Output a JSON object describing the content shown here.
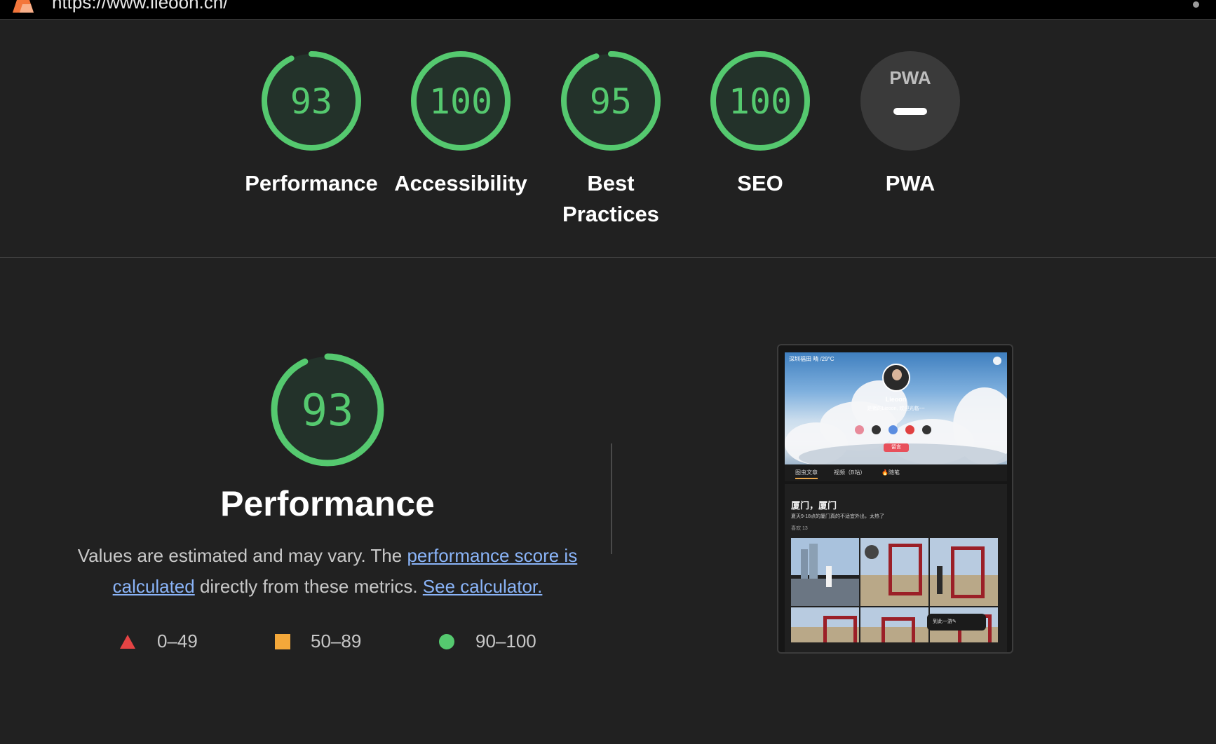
{
  "topbar": {
    "url": "https://www.lieoon.cn/"
  },
  "colors": {
    "pass": "#55c96f",
    "average": "#f4a83a",
    "fail": "#e54444",
    "gauge_bg": "#23322a",
    "na": "#3a3a3a"
  },
  "scores": [
    {
      "label": "Performance",
      "value": 93
    },
    {
      "label": "Accessibility",
      "value": 100
    },
    {
      "label": "Best Practices",
      "value": 95
    },
    {
      "label": "SEO",
      "value": 100
    },
    {
      "label": "PWA",
      "value": null,
      "badge": "PWA"
    }
  ],
  "performance": {
    "score": 93,
    "title": "Performance",
    "desc_before": "Values are estimated and may vary. The ",
    "link_score": "performance score is calculated",
    "desc_middle": " directly from these metrics. ",
    "link_calc": "See calculator."
  },
  "legend": [
    {
      "range": "0–49",
      "shape": "triangle"
    },
    {
      "range": "50–89",
      "shape": "square"
    },
    {
      "range": "90–100",
      "shape": "circle"
    }
  ],
  "screenshot": {
    "weather": "深圳福田 晴 /29°C",
    "name": "Lieoon",
    "bio": "是猪的Lieoon, 欢迎光临~~",
    "message_button": "留言",
    "tabs": [
      "图虫文章",
      "视频（B站）",
      "🔥随笔"
    ],
    "post_title": "厦门，厦门",
    "post_subtitle": "夏天9-18点的厦门真的不适宜外出，太热了",
    "post_likes": "喜欢 13",
    "fab_label": "到此一游✎"
  }
}
